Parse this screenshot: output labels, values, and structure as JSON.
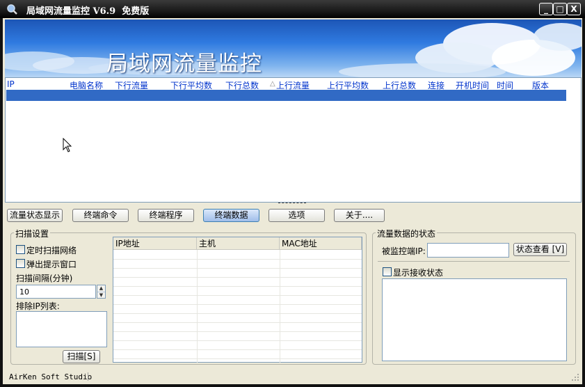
{
  "window": {
    "title": "局域网流量监控 V6.9  免费版",
    "min_label": "_",
    "max_label": "□",
    "close_label": "X"
  },
  "banner": {
    "title": "局域网流量监控"
  },
  "list": {
    "columns": [
      "IP",
      "电脑名称",
      "下行流量",
      "下行平均数",
      "下行总数",
      "上行流量",
      "上行平均数",
      "上行总数",
      "连接",
      "开机时间",
      "时间",
      "版本"
    ],
    "sort_indicator": "△"
  },
  "tabs": [
    "流量状态显示",
    "终端命令",
    "终端程序",
    "终端数据",
    "选项",
    "关于...."
  ],
  "scan": {
    "group_label": "扫描设置",
    "timer_scan_label": "定时扫描网络",
    "popup_label": "弹出提示窗口",
    "interval_label": "扫描间隔(分钟)",
    "interval_value": "10",
    "exclude_label": "排除IP列表:",
    "scan_button": "扫描[S]"
  },
  "grid": {
    "columns": [
      "IP地址",
      "主机",
      "MAC地址"
    ]
  },
  "traffic": {
    "group_label": "流量数据的状态",
    "monitored_ip_label": "被监控端IP:",
    "monitored_ip_value": "",
    "view_button": "状态查看 [V]",
    "show_receive_label": "显示接收状态"
  },
  "statusbar": {
    "text": "AirKen Soft Studio"
  }
}
